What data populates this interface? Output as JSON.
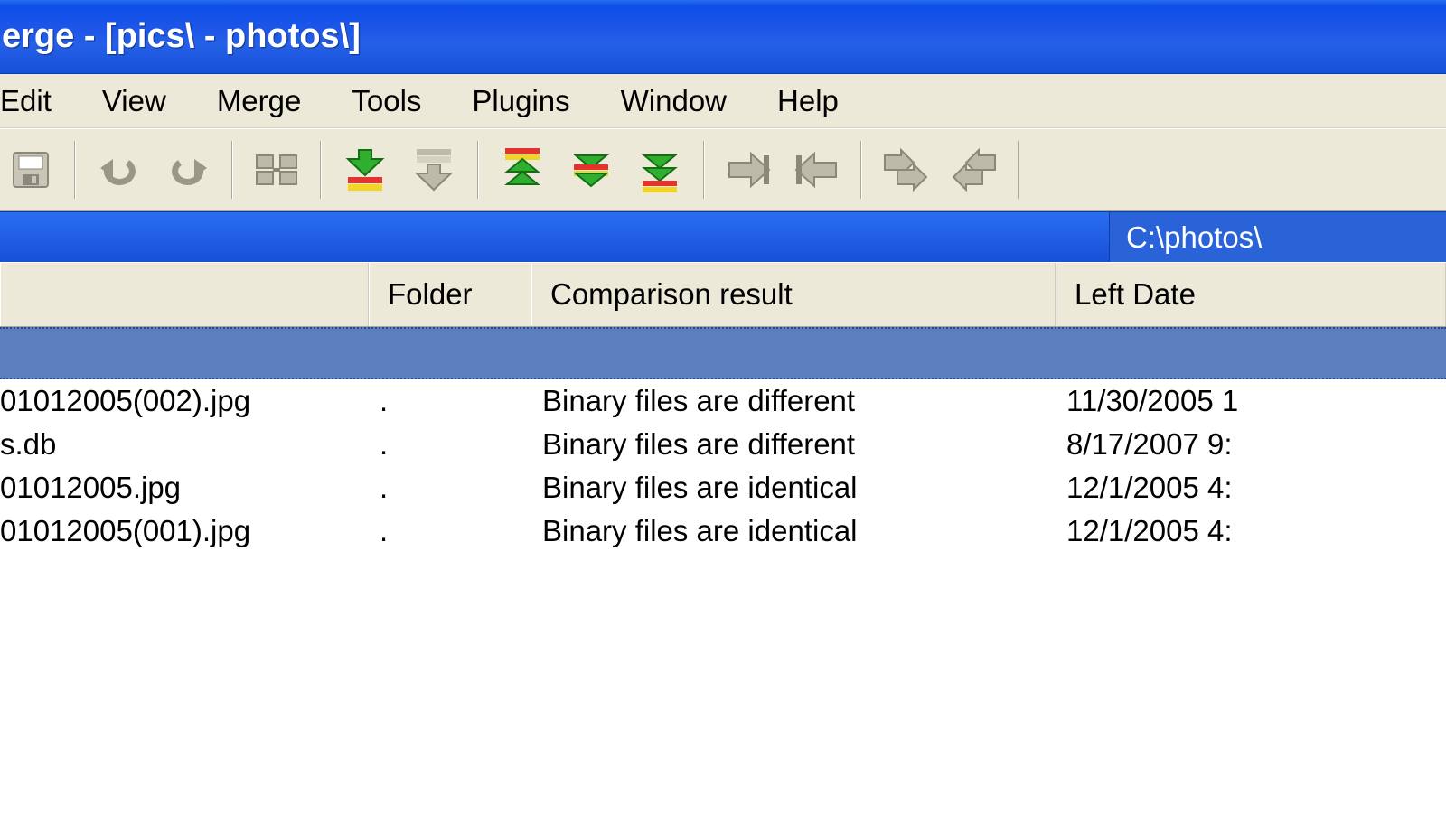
{
  "title": "erge - [pics\\ - photos\\]",
  "menu": [
    "Edit",
    "View",
    "Merge",
    "Tools",
    "Plugins",
    "Window",
    "Help"
  ],
  "right_path": "C:\\photos\\",
  "columns": {
    "name": "",
    "folder": "Folder",
    "result": "Comparison result",
    "left_date": "Left Date"
  },
  "rows": [
    {
      "name": "01012005(002).jpg",
      "folder": ".",
      "result": "Binary files are different",
      "left_date": "11/30/2005 1"
    },
    {
      "name": "s.db",
      "folder": ".",
      "result": "Binary files are different",
      "left_date": "8/17/2007 9:"
    },
    {
      "name": "01012005.jpg",
      "folder": ".",
      "result": "Binary files are identical",
      "left_date": "12/1/2005 4:"
    },
    {
      "name": "01012005(001).jpg",
      "folder": ".",
      "result": "Binary files are identical",
      "left_date": "12/1/2005 4:"
    }
  ]
}
